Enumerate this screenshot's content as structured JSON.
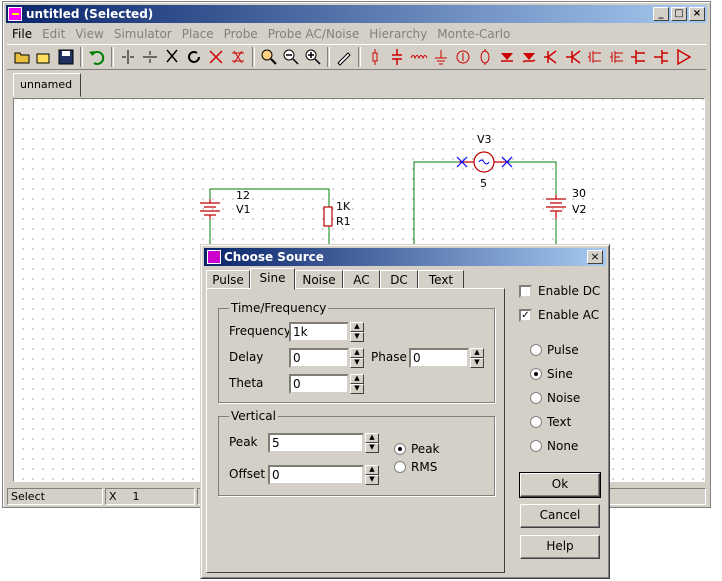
{
  "window": {
    "title": "untitled (Selected)"
  },
  "menu": [
    "File",
    "Edit",
    "View",
    "Simulator",
    "Place",
    "Probe",
    "Probe AC/Noise",
    "Hierarchy",
    "Monte-Carlo"
  ],
  "doc_tab": "unnamed",
  "schematic": {
    "v3_label": "V3",
    "v3_value": "5",
    "v1_value": "12",
    "v1_label": "V1",
    "r1_value": "1K",
    "r1_label": "R1",
    "v2_value": "30",
    "v2_label": "V2"
  },
  "status": {
    "mode": "Select",
    "x_label": "X",
    "x_value": "1"
  },
  "dialog": {
    "title": "Choose Source",
    "tabs": [
      "Pulse",
      "Sine",
      "Noise",
      "AC",
      "DC",
      "Text"
    ],
    "selected_tab": "Sine",
    "time_freq": {
      "legend": "Time/Frequency",
      "frequency_label": "Frequency",
      "frequency_value": "1k",
      "delay_label": "Delay",
      "delay_value": "0",
      "phase_label": "Phase",
      "phase_value": "0",
      "theta_label": "Theta",
      "theta_value": "0"
    },
    "vertical": {
      "legend": "Vertical",
      "peak_label": "Peak",
      "peak_value": "5",
      "offset_label": "Offset",
      "offset_value": "0",
      "mode_peak": "Peak",
      "mode_rms": "RMS",
      "mode_selected": "Peak"
    },
    "enable_dc": {
      "label": "Enable DC",
      "checked": false
    },
    "enable_ac": {
      "label": "Enable AC",
      "checked": true
    },
    "source_types": [
      "Pulse",
      "Sine",
      "Noise",
      "Text",
      "None"
    ],
    "source_selected": "Sine",
    "buttons": {
      "ok": "Ok",
      "cancel": "Cancel",
      "help": "Help"
    }
  }
}
